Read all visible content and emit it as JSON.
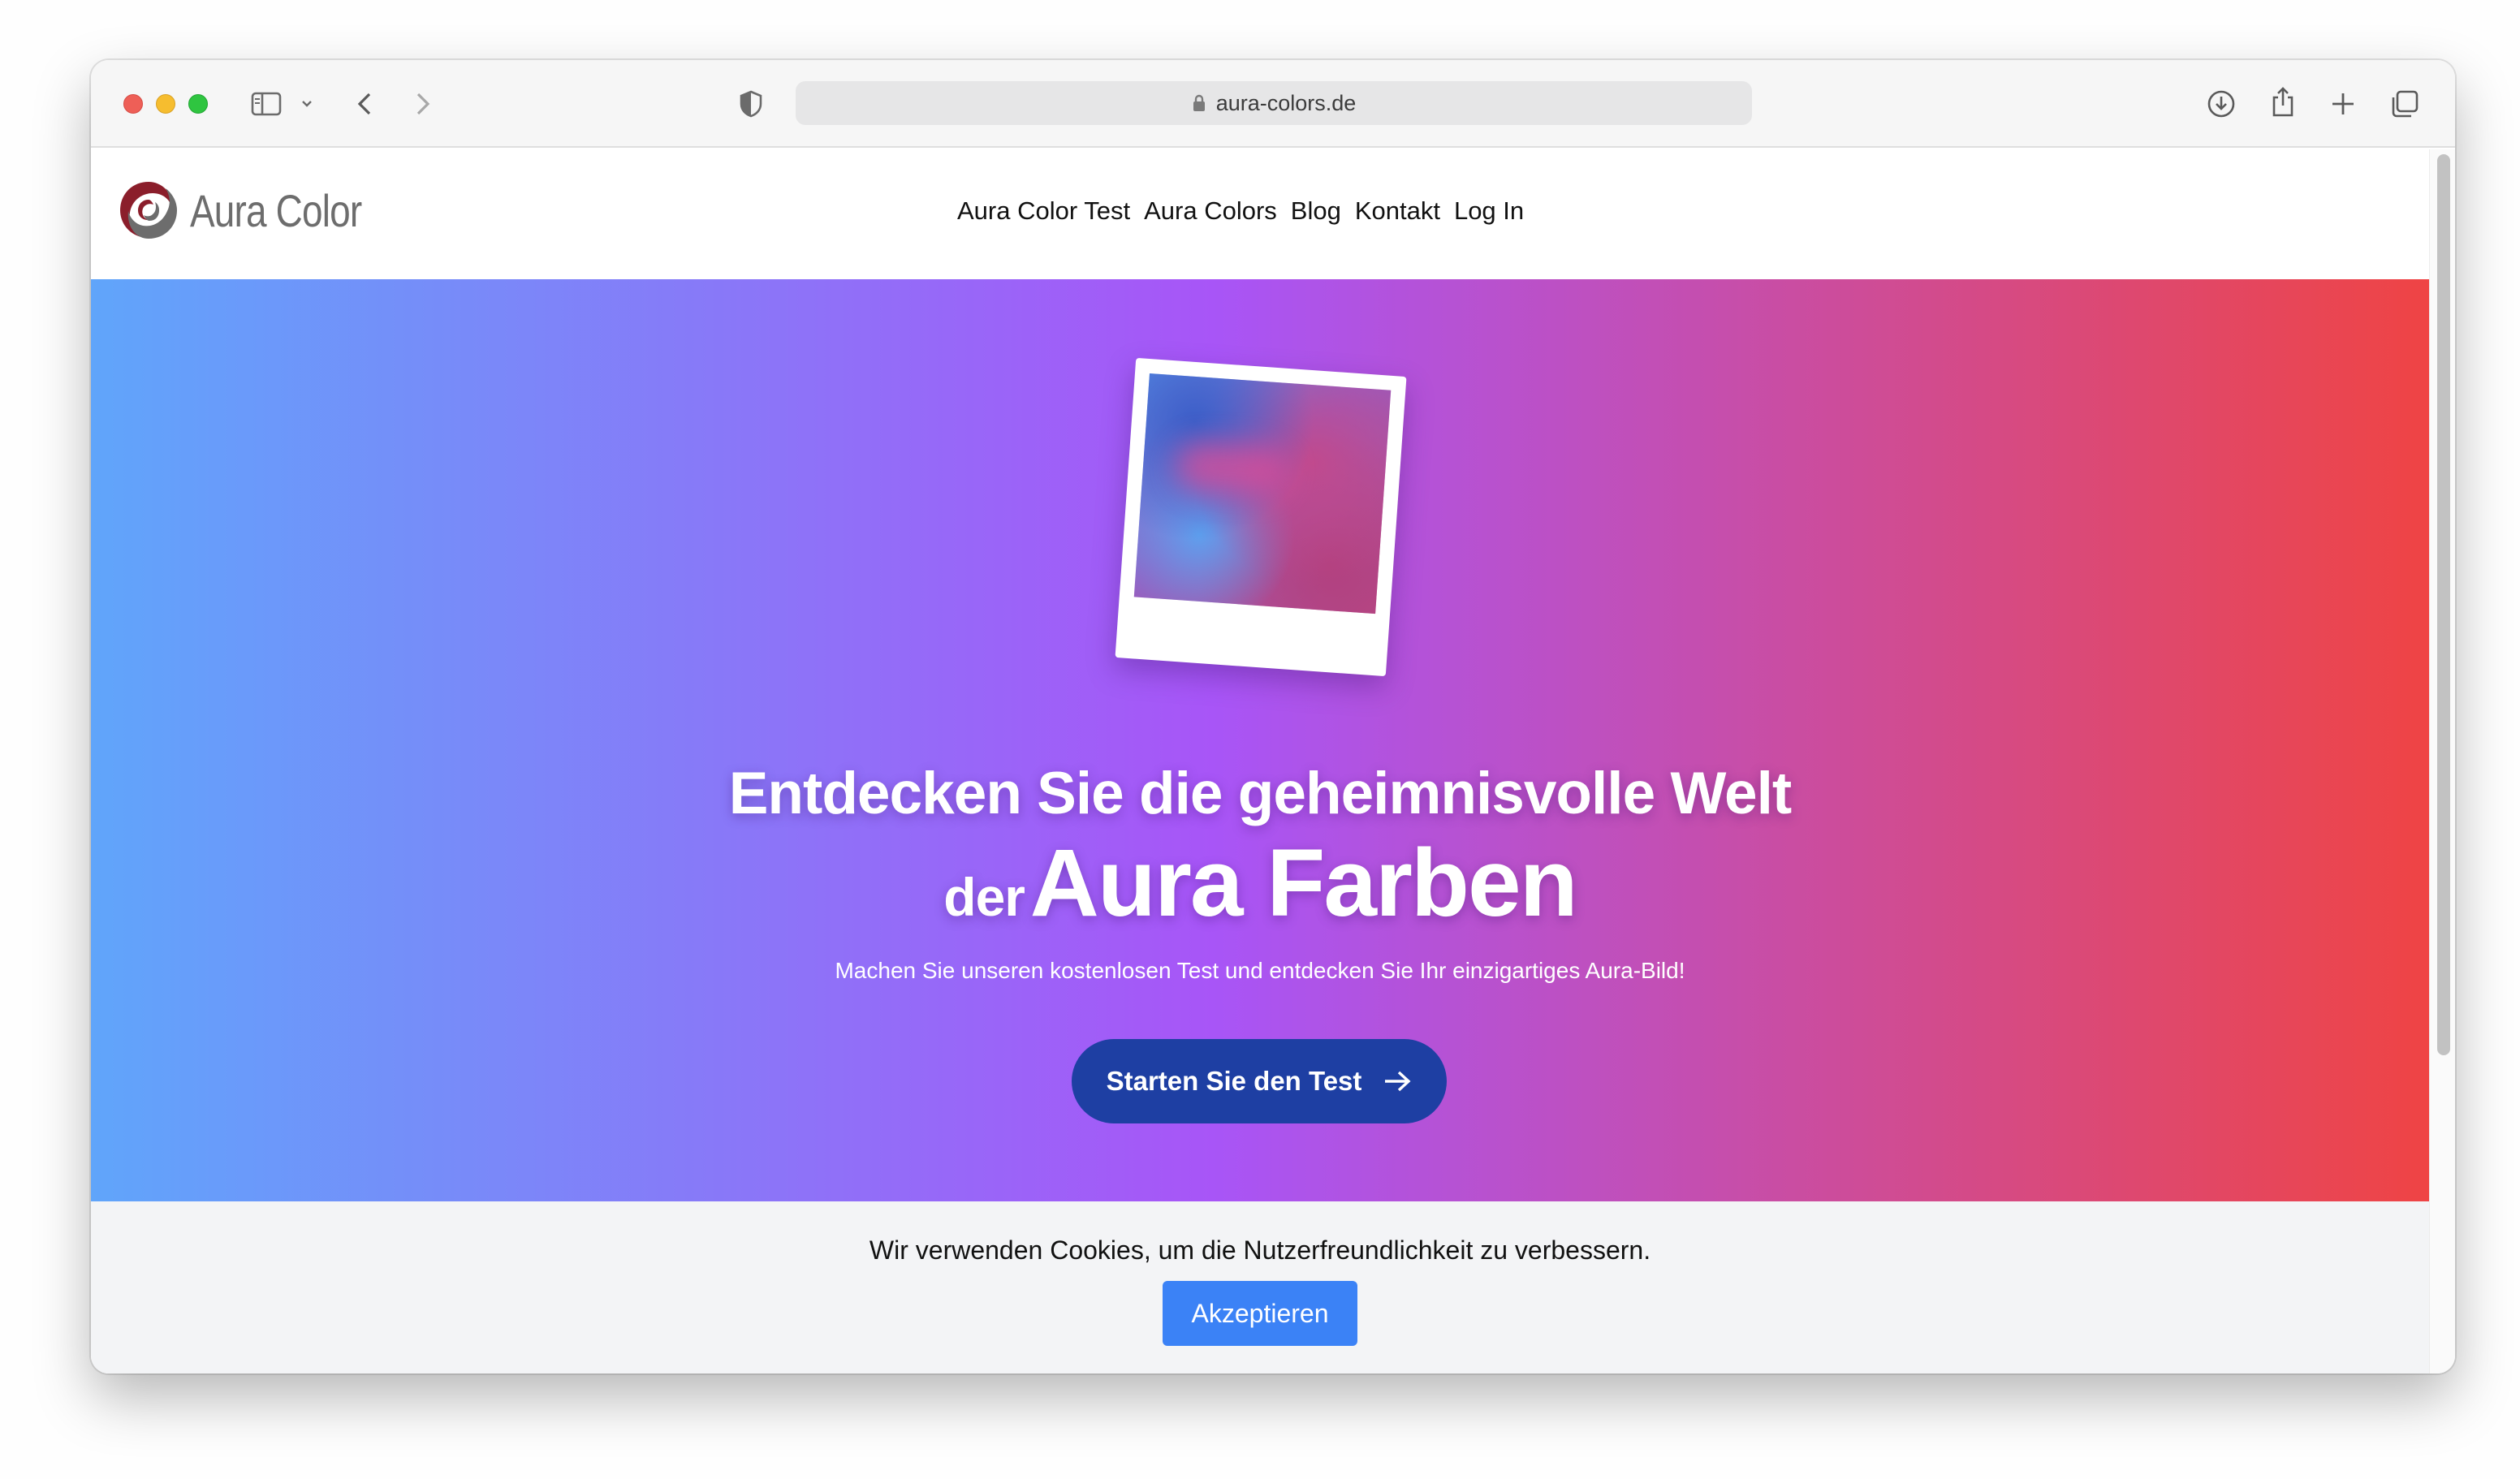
{
  "browser": {
    "url": "aura-colors.de"
  },
  "site": {
    "logo_text": "Aura Color",
    "nav": [
      "Aura Color Test",
      "Aura Colors",
      "Blog",
      "Kontakt",
      "Log In"
    ]
  },
  "hero": {
    "headline_line1": "Entdecken Sie die geheimnisvolle Welt",
    "headline_line2_prefix": "der",
    "headline_line2_main": "Aura Farben",
    "subline": "Machen Sie unseren kostenlosen Test und entdecken Sie Ihr einzigartiges Aura-Bild!",
    "cta_label": "Starten Sie den Test",
    "gradient": [
      "#60a5fa",
      "#a855f7",
      "#ef4444"
    ]
  },
  "cookie_banner": {
    "text": "Wir verwenden Cookies, um die Nutzerfreundlichkeit zu verbessern.",
    "accept_label": "Akzeptieren"
  },
  "colors": {
    "cta": "#1e3fa3",
    "accept": "#3b82f6",
    "logo_mark": "#8b1e2b"
  }
}
